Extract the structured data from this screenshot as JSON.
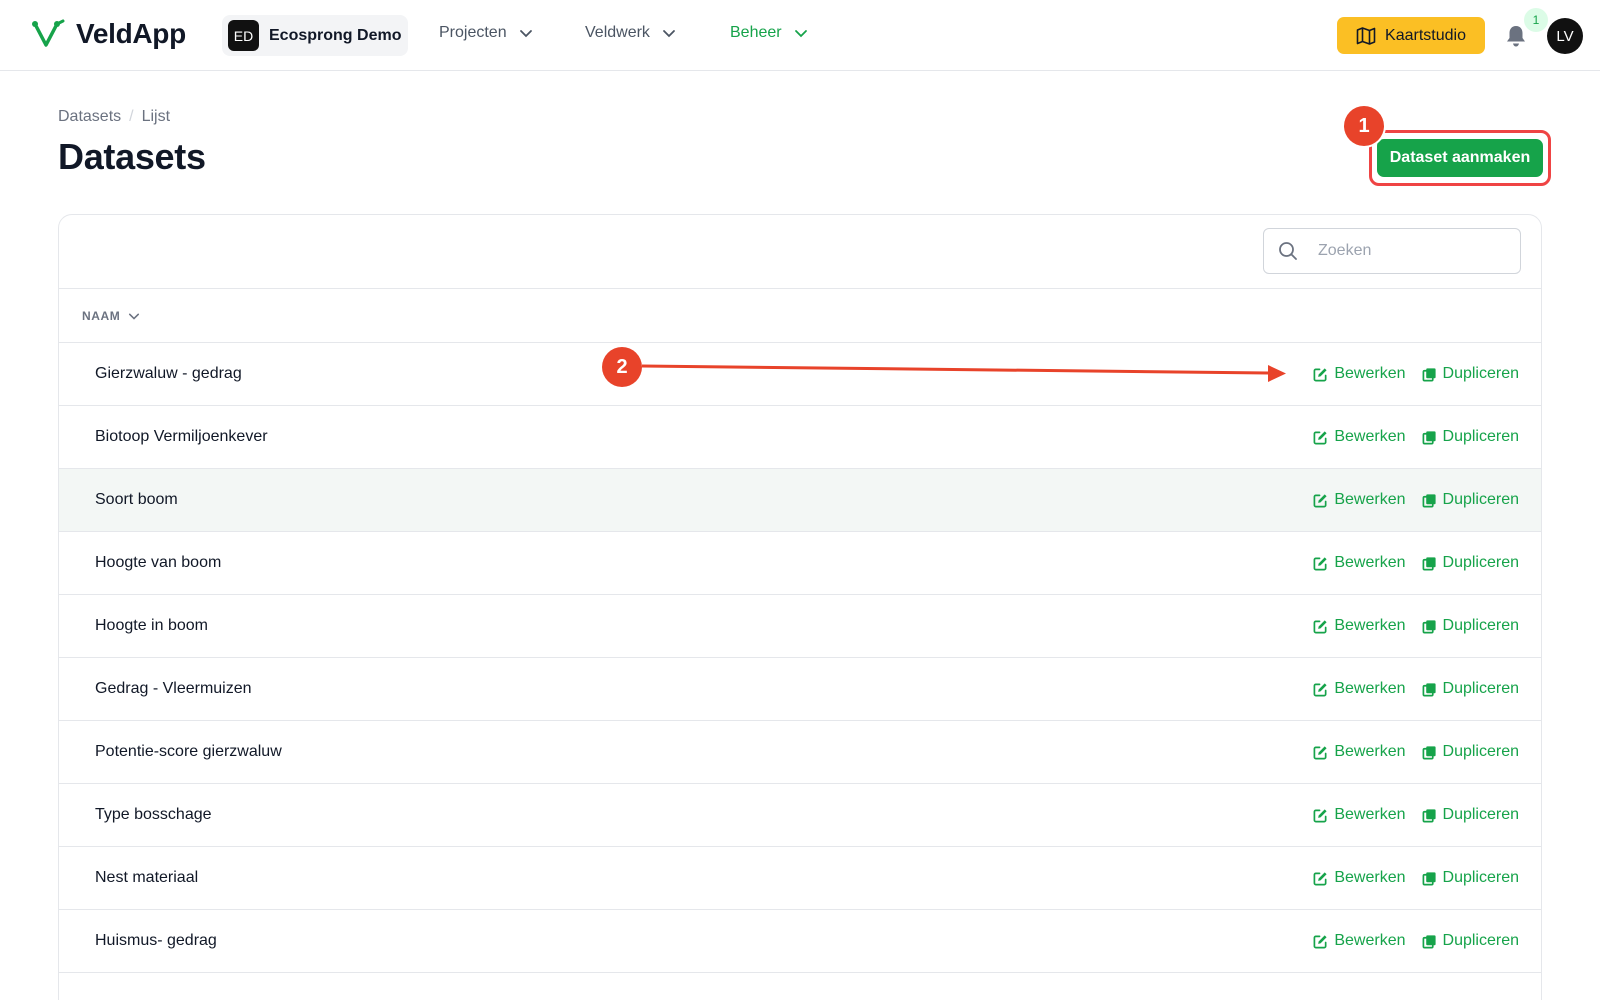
{
  "app": {
    "name": "VeldApp"
  },
  "org": {
    "initials": "ED",
    "name": "Ecosprong Demo"
  },
  "nav": [
    {
      "label": "Projecten",
      "active": false
    },
    {
      "label": "Veldwerk",
      "active": false
    },
    {
      "label": "Beheer",
      "active": true
    }
  ],
  "header_right": {
    "studio_label": "Kaartstudio",
    "notification_count": "1",
    "avatar_initials": "LV"
  },
  "breadcrumb": [
    "Datasets",
    "Lijst"
  ],
  "page": {
    "title": "Datasets",
    "create_button": "Dataset aanmaken"
  },
  "annotations": {
    "step1": "1",
    "step2": "2"
  },
  "search": {
    "placeholder": "Zoeken",
    "value": ""
  },
  "table": {
    "column": "NAAM",
    "action_edit": "Bewerken",
    "action_duplicate": "Dupliceren",
    "rows": [
      "Gierzwaluw - gedrag",
      "Biotoop Vermiljoenkever",
      "Soort boom",
      "Hoogte van boom",
      "Hoogte in boom",
      "Gedrag - Vleermuizen",
      "Potentie-score gierzwaluw",
      "Type bosschage",
      "Nest materiaal",
      "Huismus- gedrag"
    ],
    "hovered_row_index": 2
  },
  "colors": {
    "brand_green": "#16a34a",
    "accent_yellow": "#fbbf24",
    "annotation_red": "#e8432a"
  }
}
